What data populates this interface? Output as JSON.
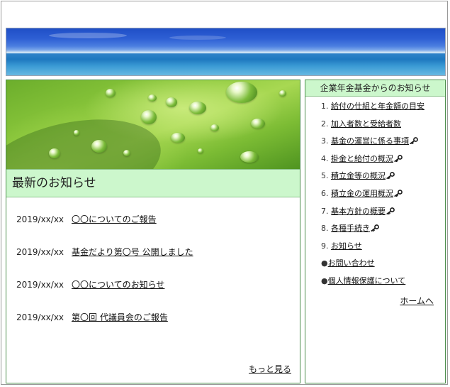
{
  "main": {
    "news_heading": "最新のお知らせ",
    "news": [
      {
        "date": "2019/xx/xx",
        "title": "〇〇についてのご報告"
      },
      {
        "date": "2019/xx/xx",
        "title": "基金だより第〇号 公開しました"
      },
      {
        "date": "2019/xx/xx",
        "title": "〇〇についてのお知らせ"
      },
      {
        "date": "2019/xx/xx",
        "title": "第〇回 代議員会のご報告"
      }
    ],
    "more_label": "もっと見る"
  },
  "side": {
    "title": "企業年金基金からのお知らせ",
    "items": [
      {
        "num": "1. ",
        "label": "給付の仕組と年金額の目安",
        "locked": false
      },
      {
        "num": "2. ",
        "label": "加入者数と受給者数",
        "locked": false
      },
      {
        "num": "3. ",
        "label": "基金の運営に係る事項",
        "locked": true
      },
      {
        "num": "4. ",
        "label": "掛金と給付の概況",
        "locked": true
      },
      {
        "num": "5. ",
        "label": "積立金等の概況",
        "locked": true
      },
      {
        "num": "6. ",
        "label": "積立金の運用概況",
        "locked": true
      },
      {
        "num": "7. ",
        "label": "基本方針の概要",
        "locked": true
      },
      {
        "num": "8. ",
        "label": "各種手続き",
        "locked": true
      },
      {
        "num": "9. ",
        "label": "お知らせ",
        "locked": false
      },
      {
        "num": "●",
        "label": "お問い合わせ",
        "locked": false
      },
      {
        "num": "●",
        "label": "個人情報保護について",
        "locked": false
      }
    ],
    "home_label": "ホームへ"
  },
  "icons": {
    "locked_item": "key-icon",
    "key_color": "#1a1a1a"
  }
}
